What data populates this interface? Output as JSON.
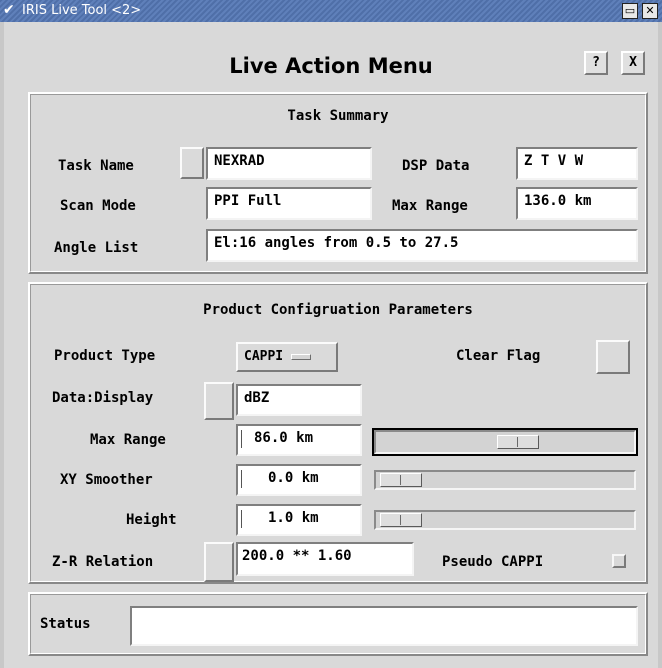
{
  "window": {
    "title": "IRIS Live Tool <2>",
    "minimize_glyph": "▭",
    "close_glyph": "✕"
  },
  "header": {
    "title": "Live Action Menu",
    "help_label": "?",
    "close_label": "X"
  },
  "task_summary": {
    "title": "Task Summary",
    "task_name_label": "Task Name",
    "task_name_value": "NEXRAD",
    "dsp_data_label": "DSP Data",
    "dsp_data_value": "Z T V W",
    "scan_mode_label": "Scan Mode",
    "scan_mode_value": "PPI Full",
    "max_range_label": "Max Range",
    "max_range_value": "136.0 km",
    "angle_list_label": "Angle List",
    "angle_list_value": "El:16 angles from 0.5 to 27.5"
  },
  "product_config": {
    "title": "Product Configruation Parameters",
    "product_type_label": "Product Type",
    "product_type_value": "CAPPI",
    "clear_flag_label": "Clear Flag",
    "data_display_label": "Data:Display",
    "data_display_value": "dBZ",
    "max_range_label": "Max Range",
    "max_range_value": "86.0 km",
    "xy_smoother_label": "XY Smoother",
    "xy_smoother_value": "0.0 km",
    "height_label": "Height",
    "height_value": "1.0 km",
    "zr_label": "Z-R Relation",
    "zr_value": "200.0 ** 1.60",
    "pseudo_cappi_label": "Pseudo CAPPI",
    "max_range_slider_fraction": 0.55,
    "xy_smoother_slider_fraction": 0.0,
    "height_slider_fraction": 0.0
  },
  "status": {
    "label": "Status",
    "value": ""
  }
}
